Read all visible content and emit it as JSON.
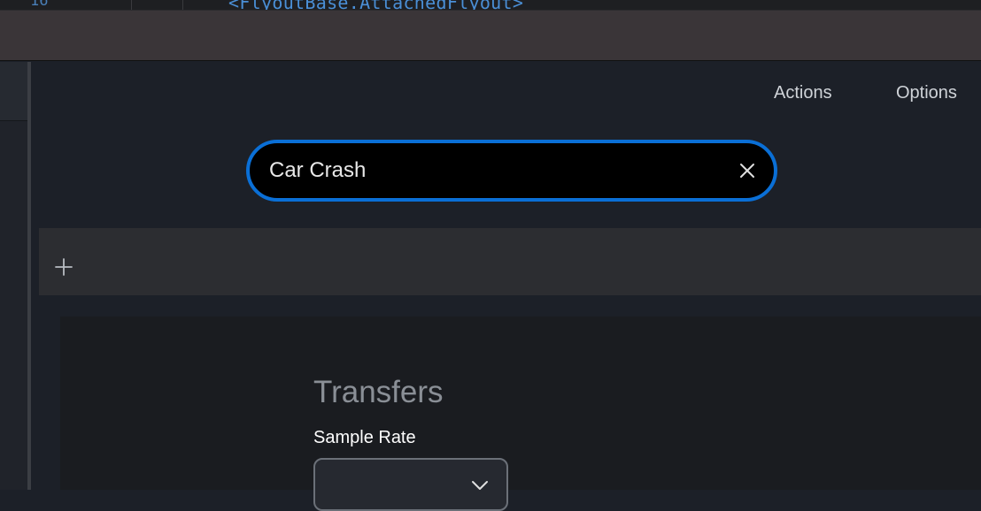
{
  "editor": {
    "line_number": "16",
    "code_line": "<FlyoutBase.AttachedFlyout>"
  },
  "menu": {
    "actions": "Actions",
    "options": "Options"
  },
  "search": {
    "value": "Car Crash"
  },
  "panel": {
    "title": "Transfers",
    "sample_rate_label": "Sample Rate",
    "sample_rate_value": ""
  },
  "colors": {
    "accent": "#0a6fd6",
    "background": "#1c2028",
    "toolbar": "#2c2d31",
    "title_bar": "#3a3538"
  },
  "icons": [
    "close-icon",
    "plus-icon",
    "chevron-down-icon"
  ]
}
